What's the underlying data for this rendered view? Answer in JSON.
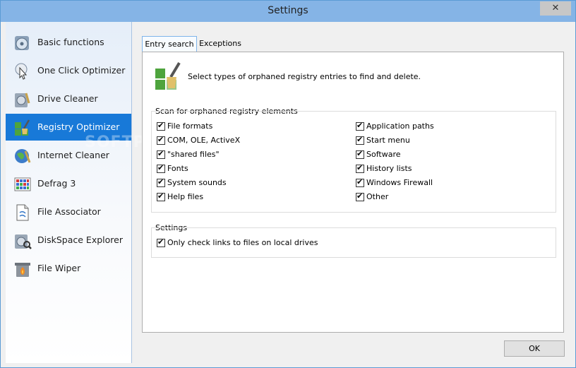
{
  "window": {
    "title": "Settings",
    "close_symbol": "✕"
  },
  "sidebar": {
    "selected_index": 3,
    "items": [
      {
        "label": "Basic functions",
        "icon": "basic-functions-icon"
      },
      {
        "label": "One Click Optimizer",
        "icon": "one-click-optimizer-icon"
      },
      {
        "label": "Drive Cleaner",
        "icon": "drive-cleaner-icon"
      },
      {
        "label": "Registry Optimizer",
        "icon": "registry-optimizer-icon"
      },
      {
        "label": "Internet Cleaner",
        "icon": "internet-cleaner-icon"
      },
      {
        "label": "Defrag 3",
        "icon": "defrag-icon"
      },
      {
        "label": "File Associator",
        "icon": "file-associator-icon"
      },
      {
        "label": "DiskSpace Explorer",
        "icon": "diskspace-explorer-icon"
      },
      {
        "label": "File Wiper",
        "icon": "file-wiper-icon"
      }
    ]
  },
  "tabs": [
    {
      "label": "Entry search",
      "active": true
    },
    {
      "label": "Exceptions",
      "active": false
    }
  ],
  "panel": {
    "header_text": "Select types of orphaned registry entries to find and delete.",
    "scan_group": {
      "title": "Scan for orphaned registry elements",
      "left": [
        {
          "label": "File formats",
          "checked": true
        },
        {
          "label": "COM, OLE, ActiveX",
          "checked": true
        },
        {
          "label": "\"shared files\"",
          "checked": true
        },
        {
          "label": "Fonts",
          "checked": true
        },
        {
          "label": "System sounds",
          "checked": true
        },
        {
          "label": "Help files",
          "checked": true
        }
      ],
      "right": [
        {
          "label": "Application paths",
          "checked": true
        },
        {
          "label": "Start menu",
          "checked": true
        },
        {
          "label": "Software",
          "checked": true
        },
        {
          "label": "History lists",
          "checked": true
        },
        {
          "label": "Windows Firewall",
          "checked": true
        },
        {
          "label": "Other",
          "checked": true
        }
      ]
    },
    "settings_group": {
      "title": "Settings",
      "items": [
        {
          "label": "Only check links to files on local drives",
          "checked": true
        }
      ]
    }
  },
  "ok_label": "OK",
  "watermark": "SOFTP",
  "colors": {
    "title_bar": "#85b4e6",
    "selected": "#1879d8",
    "accent_green": "#4ea43d"
  }
}
